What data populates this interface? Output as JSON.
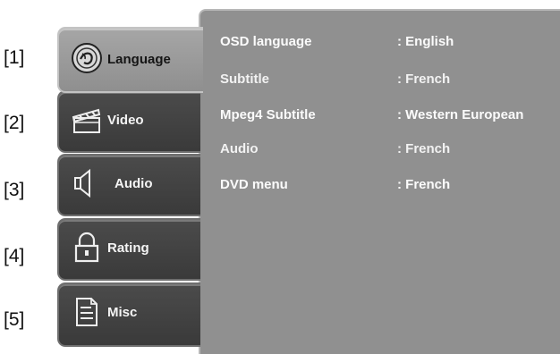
{
  "markers": [
    "[1]",
    "[2]",
    "[3]",
    "[4]",
    "[5]"
  ],
  "tabs": [
    {
      "label": "Language",
      "icon": "language-icon",
      "active": true
    },
    {
      "label": "Video",
      "icon": "clapperboard-icon",
      "active": false
    },
    {
      "label": "Audio",
      "icon": "speaker-icon",
      "active": false
    },
    {
      "label": "Rating",
      "icon": "padlock-icon",
      "active": false
    },
    {
      "label": "Misc",
      "icon": "document-icon",
      "active": false
    }
  ],
  "settings": [
    {
      "label": "OSD language",
      "value": ": English"
    },
    {
      "label": "Subtitle",
      "value": ": French"
    },
    {
      "label": "Mpeg4 Subtitle",
      "value": ": Western European"
    },
    {
      "label": "Audio",
      "value": ": French"
    },
    {
      "label": "DVD menu",
      "value": ": French"
    }
  ],
  "colors": {
    "panel": "#909090",
    "tab_active": "#9c9c9c",
    "tab_inactive": "#404040",
    "text_light": "#fbfbfb"
  }
}
